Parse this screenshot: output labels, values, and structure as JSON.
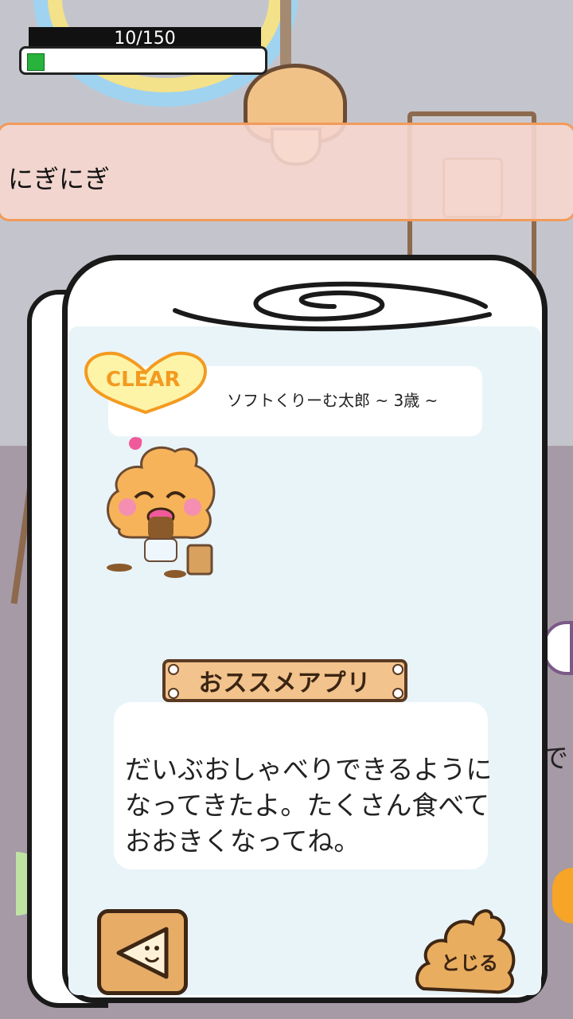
{
  "hud": {
    "hp_text": "10/150",
    "hp_fraction": 0.0667,
    "hp_fill_color": "#27b33c"
  },
  "banner": {
    "text": "にぎにぎ"
  },
  "status": {
    "clear_label": "CLEAR",
    "character_name": "ソフトくりーむ太郎 ~ 3歳 ~"
  },
  "recommend": {
    "label": "おススメアプリ"
  },
  "message": {
    "lines": [
      "だいぶおしゃべりできるように",
      "なってきたよ。たくさん食べて",
      "おおきくなってね。"
    ]
  },
  "background": {
    "side_text": "で"
  },
  "buttons": {
    "back_icon": "triangle-face-icon",
    "close_label": "とじる"
  },
  "colors": {
    "accent": "#f39a20",
    "banner_border": "#f29a5c",
    "wood": "#f2c38c"
  }
}
